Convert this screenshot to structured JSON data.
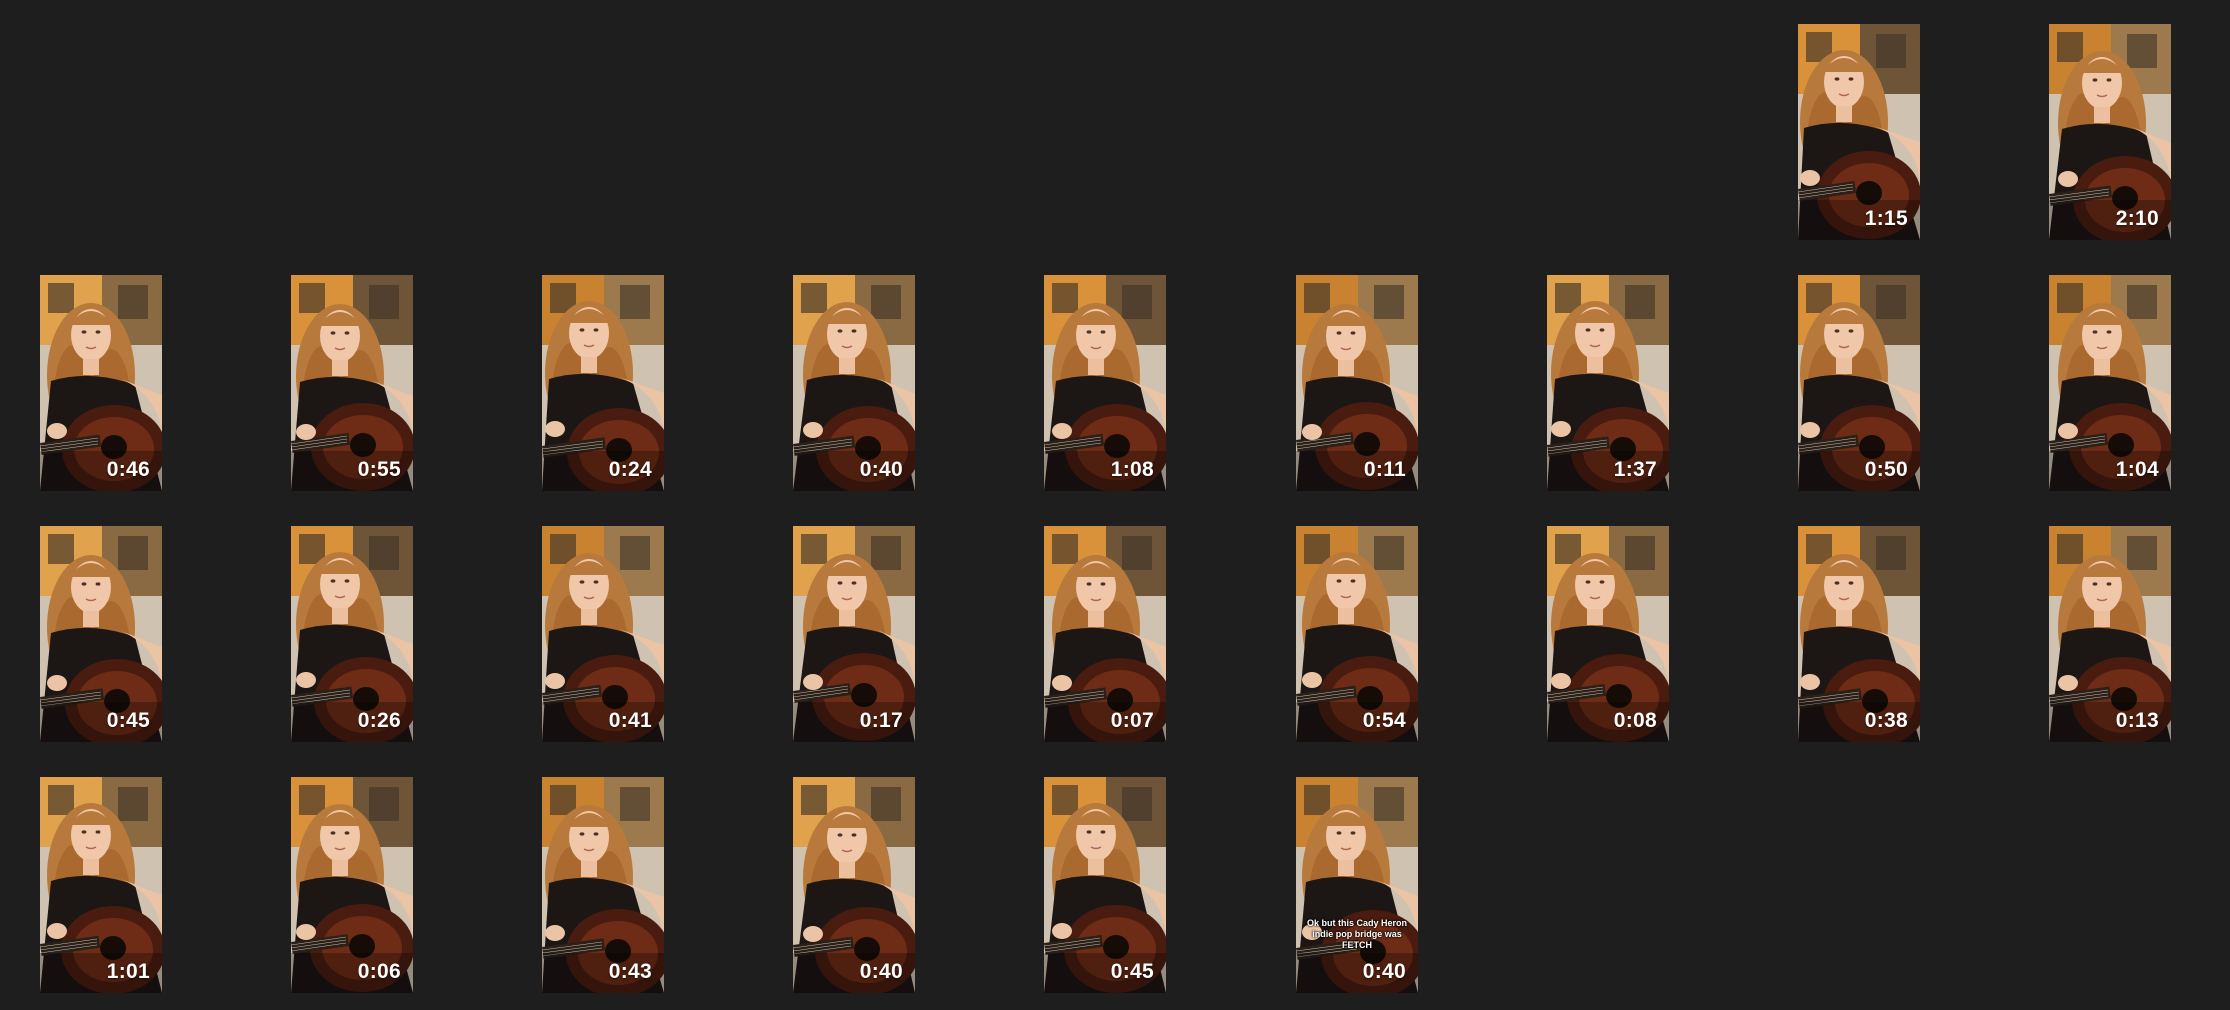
{
  "videos": [
    {
      "duration": "1:15"
    },
    {
      "duration": "2:10"
    },
    {
      "duration": "0:46"
    },
    {
      "duration": "0:55"
    },
    {
      "duration": "0:24"
    },
    {
      "duration": "0:40"
    },
    {
      "duration": "1:08"
    },
    {
      "duration": "0:11"
    },
    {
      "duration": "1:37"
    },
    {
      "duration": "0:50"
    },
    {
      "duration": "1:04"
    },
    {
      "duration": "0:45"
    },
    {
      "duration": "0:26"
    },
    {
      "duration": "0:41"
    },
    {
      "duration": "0:17"
    },
    {
      "duration": "0:07"
    },
    {
      "duration": "0:54"
    },
    {
      "duration": "0:08"
    },
    {
      "duration": "0:38"
    },
    {
      "duration": "0:13"
    },
    {
      "duration": "1:01"
    },
    {
      "duration": "0:06"
    },
    {
      "duration": "0:43"
    },
    {
      "duration": "0:40"
    },
    {
      "duration": "0:45"
    },
    {
      "duration": "0:40",
      "caption": "Ok but this Cady Heron indie pop bridge was FETCH"
    }
  ],
  "colors": {
    "background": "#1e1e1e",
    "duration_text": "#ffffff"
  }
}
